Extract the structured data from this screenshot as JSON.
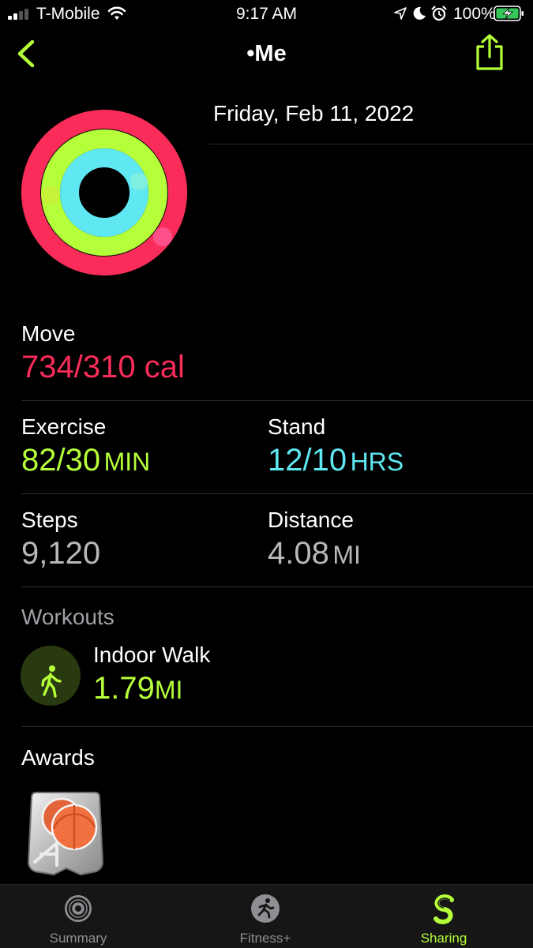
{
  "status_bar": {
    "carrier": "T-Mobile",
    "time": "9:17 AM",
    "battery": "100%"
  },
  "nav": {
    "title": "•Me"
  },
  "date": "Friday, Feb 11, 2022",
  "rings": {
    "move_progress": 2.37,
    "exercise_progress": 2.73,
    "stand_progress": 1.2,
    "colors": {
      "move": "#fa2d5a",
      "exercise": "#b5ff3a",
      "stand": "#5fe8f2"
    }
  },
  "move": {
    "label": "Move",
    "value": "734/310 cal"
  },
  "exercise": {
    "label": "Exercise",
    "value": "82/30",
    "unit": "MIN"
  },
  "stand": {
    "label": "Stand",
    "value": "12/10",
    "unit": "HRS"
  },
  "steps": {
    "label": "Steps",
    "value": "9,120"
  },
  "distance": {
    "label": "Distance",
    "value": "4.08",
    "unit": "MI"
  },
  "workouts": {
    "header": "Workouts",
    "items": [
      {
        "name": "Indoor Walk",
        "value": "1.79",
        "unit": "MI",
        "icon": "walking-person-icon"
      }
    ]
  },
  "awards": {
    "header": "Awards",
    "items": [
      {
        "icon": "basketball-award-icon"
      }
    ]
  },
  "tab_bar": {
    "tabs": [
      {
        "label": "Summary",
        "icon": "summary-rings-icon",
        "active": false
      },
      {
        "label": "Fitness+",
        "icon": "fitness-plus-icon",
        "active": false
      },
      {
        "label": "Sharing",
        "icon": "sharing-icon",
        "active": true
      }
    ],
    "active_color": "#b5ff3a",
    "inactive_color": "#8e8e93"
  }
}
